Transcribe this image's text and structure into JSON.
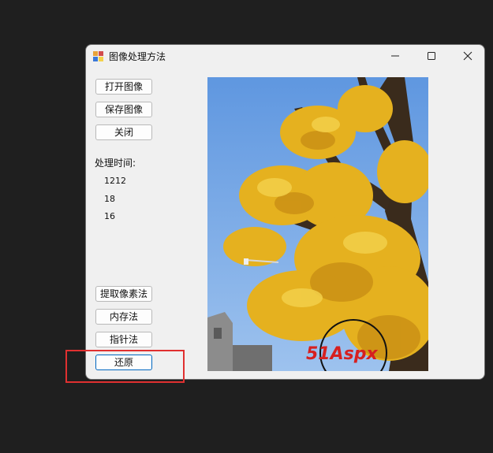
{
  "window": {
    "title": "图像处理方法"
  },
  "buttons": {
    "open_image": "打开图像",
    "save_image": "保存图像",
    "close": "关闭",
    "extract_pixel": "提取像素法",
    "memory": "内存法",
    "pointer": "指针法",
    "restore": "还原"
  },
  "timing": {
    "label": "处理时间:",
    "values": [
      "1212",
      "18",
      "16"
    ]
  },
  "watermark": {
    "text": "51Aspx"
  },
  "colors": {
    "accent": "#0067c0",
    "annotation": "#e03030",
    "sky": "#6aa2e6",
    "foliage": "#e8b31e"
  }
}
